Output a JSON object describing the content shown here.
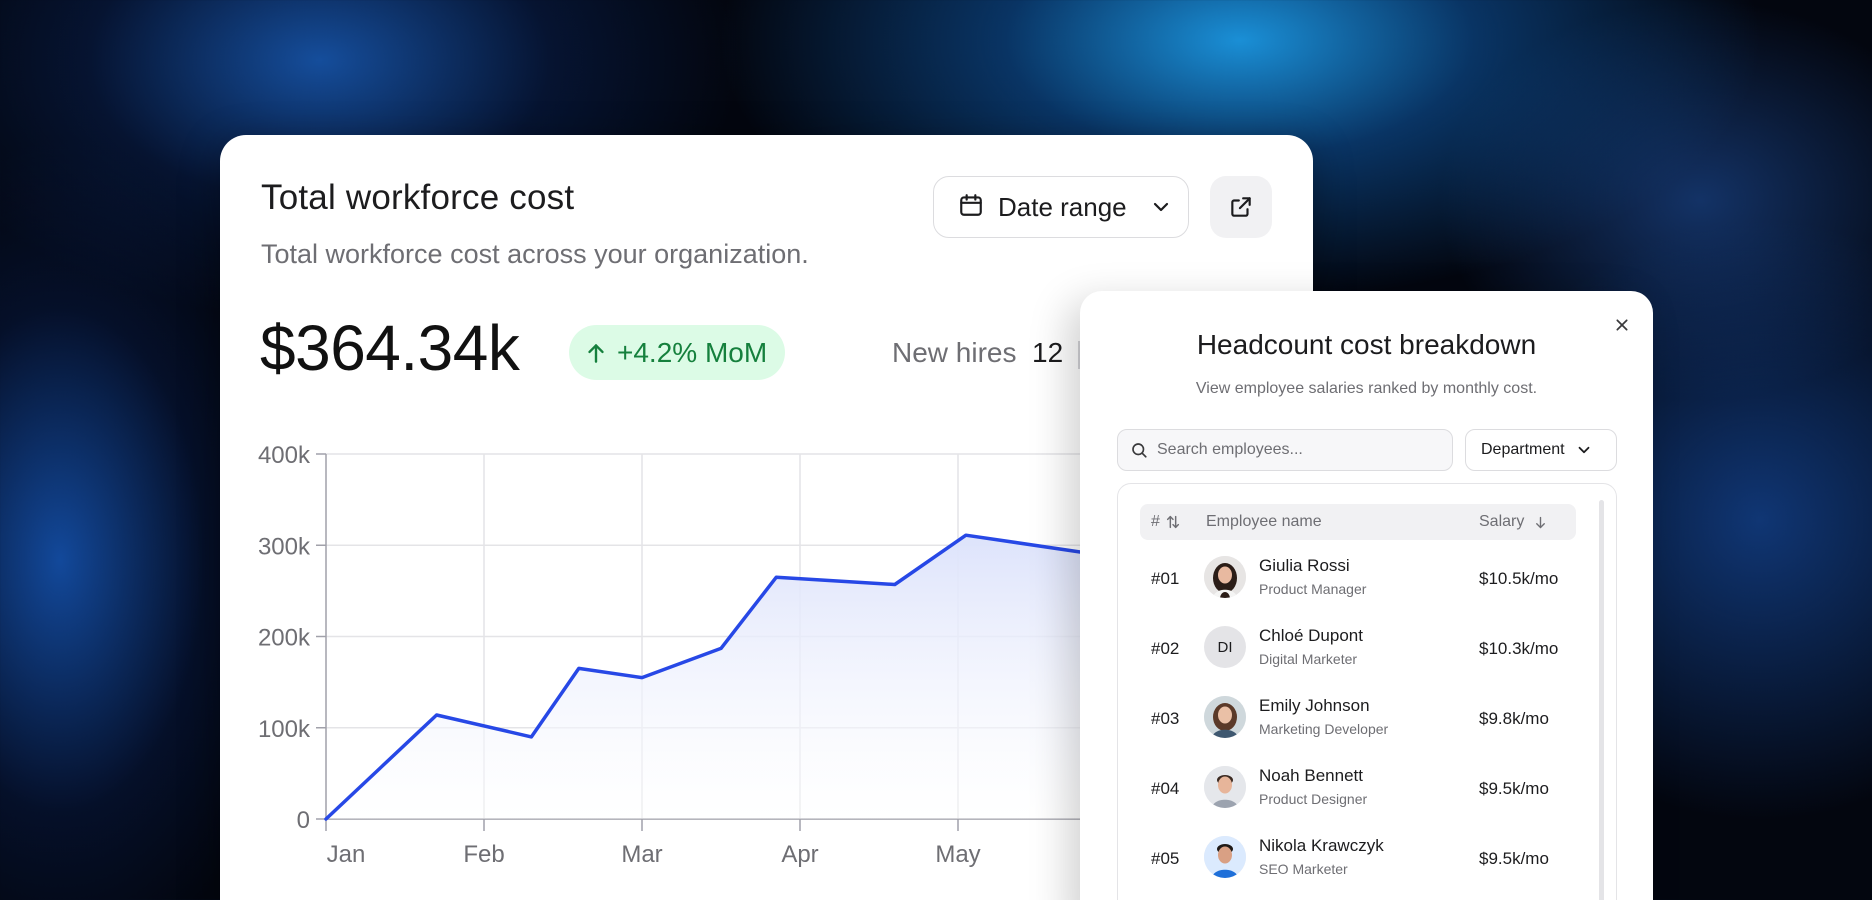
{
  "main": {
    "title": "Total workforce cost",
    "subtitle": "Total workforce cost across your organization.",
    "date_range_label": "Date range",
    "total_value": "$364.34k",
    "mom_change": "+4.2% MoM",
    "new_hires_label": "New hires",
    "new_hires_value": "12"
  },
  "chart_data": {
    "type": "area",
    "x": [
      0,
      0.7,
      1.3,
      1.6,
      2.0,
      2.5,
      2.85,
      3.6,
      4.05,
      4.8
    ],
    "values": [
      0,
      114000,
      90000,
      165000,
      155000,
      187000,
      265000,
      257000,
      311000,
      292000
    ],
    "x_tick_labels": [
      "Jan",
      "Feb",
      "Mar",
      "Apr",
      "May"
    ],
    "x_tick_positions": [
      0,
      1,
      2,
      3,
      4
    ],
    "y_ticks": [
      0,
      100000,
      200000,
      300000,
      400000
    ],
    "y_tick_labels": [
      "0",
      "100k",
      "200k",
      "300k",
      "400k"
    ],
    "ylim": [
      0,
      400000
    ],
    "grid": true,
    "line_color": "#2748e6",
    "fill_color": "#dde3fb"
  },
  "panel": {
    "title": "Headcount cost breakdown",
    "subtitle": "View employee salaries ranked by monthly cost.",
    "search_placeholder": "Search employees...",
    "department_label": "Department",
    "columns": {
      "rank": "#",
      "name": "Employee name",
      "salary": "Salary"
    },
    "rows": [
      {
        "rank": "#01",
        "name": "Giulia Rossi",
        "role": "Product Manager",
        "salary": "$10.5k/mo",
        "avatar": "photo"
      },
      {
        "rank": "#02",
        "name": "Chloé Dupont",
        "role": "Digital Marketer",
        "salary": "$10.3k/mo",
        "initials": "DI"
      },
      {
        "rank": "#03",
        "name": "Emily Johnson",
        "role": "Marketing Developer",
        "salary": "$9.8k/mo",
        "avatar": "photo"
      },
      {
        "rank": "#04",
        "name": "Noah Bennett",
        "role": "Product Designer",
        "salary": "$9.5k/mo",
        "avatar": "photo"
      },
      {
        "rank": "#05",
        "name": "Nikola Krawczyk",
        "role": "SEO Marketer",
        "salary": "$9.5k/mo",
        "avatar": "photo"
      }
    ]
  },
  "colors": {
    "accent": "#2748e6",
    "badge_bg": "#dcfbe6",
    "badge_text": "#15803d"
  },
  "icons": {
    "calendar": "calendar-icon",
    "chevron": "chevron-down-icon",
    "external": "external-link-icon",
    "arrow_up": "arrow-up-icon",
    "close": "close-icon",
    "search": "search-icon",
    "sort": "sort-icon",
    "sort_desc": "arrow-down-icon"
  }
}
